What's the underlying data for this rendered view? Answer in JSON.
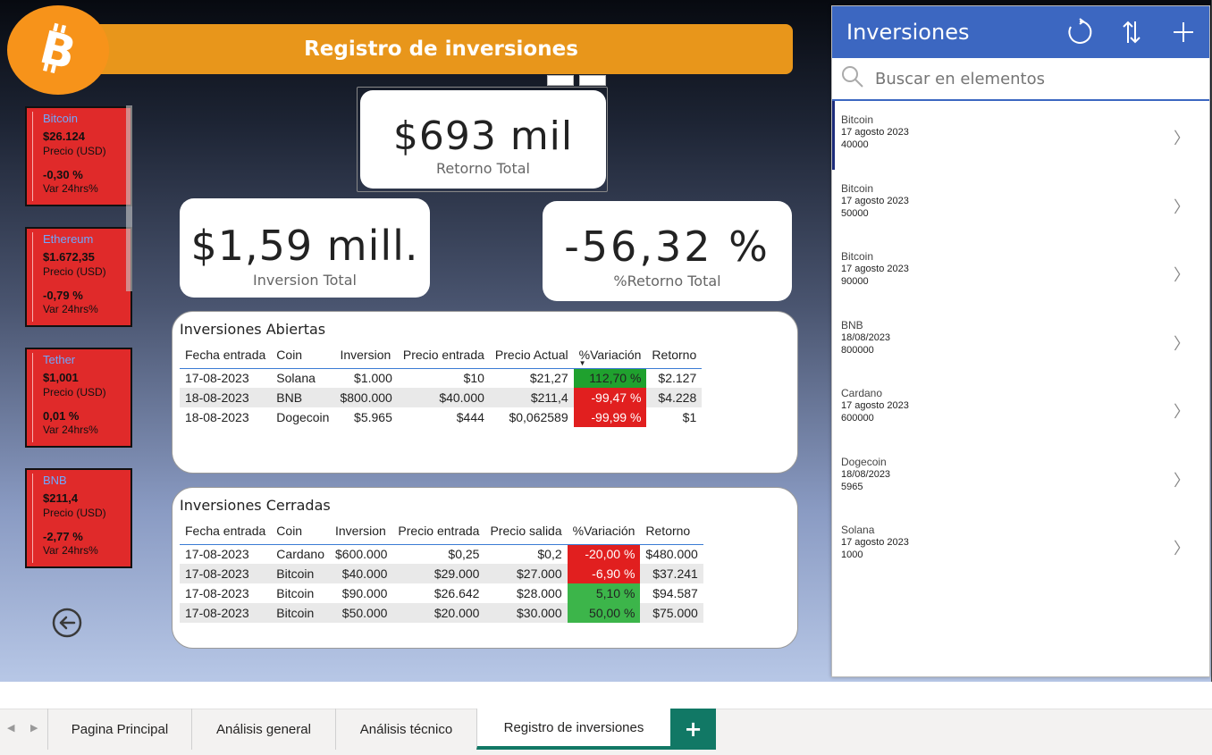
{
  "header": {
    "title": "Registro de inversiones"
  },
  "coins": [
    {
      "name": "Bitcoin",
      "price": "$26.124",
      "price_label": "Precio (USD)",
      "var": "-0,30 %",
      "var_label": "Var 24hrs%"
    },
    {
      "name": "Ethereum",
      "price": "$1.672,35",
      "price_label": "Precio (USD)",
      "var": "-0,79 %",
      "var_label": "Var 24hrs%"
    },
    {
      "name": "Tether",
      "price": "$1,001",
      "price_label": "Precio (USD)",
      "var": "0,01 %",
      "var_label": "Var 24hrs%"
    },
    {
      "name": "BNB",
      "price": "$211,4",
      "price_label": "Precio (USD)",
      "var": "-2,77 %",
      "var_label": "Var 24hrs%"
    }
  ],
  "kpis": {
    "retorno": {
      "value": "$693 mil",
      "label": "Retorno Total"
    },
    "inversion": {
      "value": "$1,59 mill.",
      "label": "Inversion Total"
    },
    "pct": {
      "value": "-56,32 %",
      "label": "%Retorno Total"
    }
  },
  "abiertas": {
    "title": "Inversiones Abiertas",
    "columns": [
      "Fecha entrada",
      "Coin",
      "Inversion",
      "Precio entrada",
      "Precio Actual",
      "%Variación",
      "Retorno"
    ],
    "rows": [
      [
        "17-08-2023",
        "Solana",
        "$1.000",
        "$10",
        "$21,27",
        "112,70 %",
        "$2.127"
      ],
      [
        "18-08-2023",
        "BNB",
        "$800.000",
        "$40.000",
        "$211,4",
        "-99,47 %",
        "$4.228"
      ],
      [
        "18-08-2023",
        "Dogecoin",
        "$5.965",
        "$444",
        "$0,062589",
        "-99,99 %",
        "$1"
      ]
    ]
  },
  "cerradas": {
    "title": "Inversiones Cerradas",
    "columns": [
      "Fecha entrada",
      "Coin",
      "Inversion",
      "Precio entrada",
      "Precio salida",
      "%Variación",
      "Retorno"
    ],
    "rows": [
      [
        "17-08-2023",
        "Cardano",
        "$600.000",
        "$0,25",
        "$0,2",
        "-20,00 %",
        "$480.000"
      ],
      [
        "17-08-2023",
        "Bitcoin",
        "$40.000",
        "$29.000",
        "$27.000",
        "-6,90 %",
        "$37.241"
      ],
      [
        "17-08-2023",
        "Bitcoin",
        "$90.000",
        "$26.642",
        "$28.000",
        "5,10 %",
        "$94.587"
      ],
      [
        "17-08-2023",
        "Bitcoin",
        "$50.000",
        "$20.000",
        "$30.000",
        "50,00 %",
        "$75.000"
      ]
    ]
  },
  "panel": {
    "title": "Inversiones",
    "search_placeholder": "Buscar en elementos",
    "items": [
      {
        "coin": "Bitcoin",
        "date": "17 agosto 2023",
        "amount": "40000"
      },
      {
        "coin": "Bitcoin",
        "date": "17 agosto 2023",
        "amount": "50000"
      },
      {
        "coin": "Bitcoin",
        "date": "17 agosto 2023",
        "amount": "90000"
      },
      {
        "coin": "BNB",
        "date": "18/08/2023",
        "amount": "800000"
      },
      {
        "coin": "Cardano",
        "date": "17 agosto 2023",
        "amount": "600000"
      },
      {
        "coin": "Dogecoin",
        "date": "18/08/2023",
        "amount": "5965"
      },
      {
        "coin": "Solana",
        "date": "17 agosto 2023",
        "amount": "1000"
      }
    ]
  },
  "tabs": [
    "Pagina Principal",
    "Análisis general",
    "Análisis técnico",
    "Registro de inversiones"
  ],
  "colors": {
    "accent_orange": "#e8961b",
    "bitcoin": "#f7931a",
    "card_red": "#e02a2a",
    "panel_blue": "#3c67c1",
    "tab_green": "#117865",
    "positive": "#3cb54a",
    "negative": "#e11f1f"
  }
}
